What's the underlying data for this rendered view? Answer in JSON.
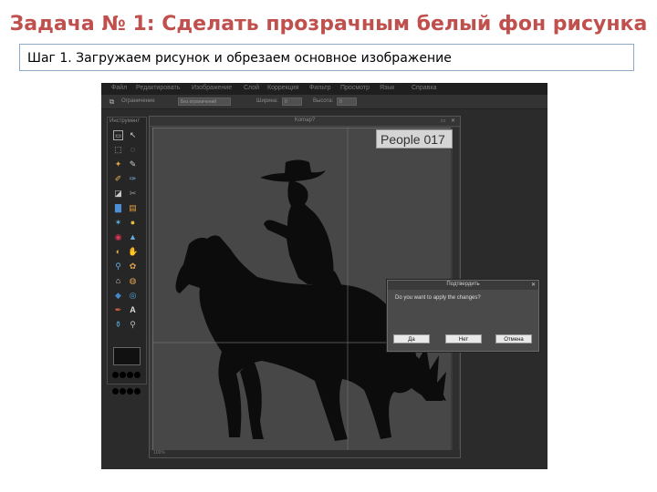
{
  "slide": {
    "title": "Задача № 1: Сделать прозрачным белый фон рисунка",
    "step": "Шаг 1. Загружаем рисунок и обрезаем основное изображение"
  },
  "editor": {
    "menu": [
      "Файл",
      "Редактировать",
      "Изображение",
      "Слой",
      "Коррекция",
      "Фильтр",
      "Просмотр",
      "Язык",
      "Справка"
    ],
    "options": {
      "label1": "Ограничение",
      "select1": "Без ограничений",
      "label2": "Ширина:",
      "value2": "0",
      "label3": "Высота:",
      "value3": "0"
    },
    "toolbox_title": "Инструмент",
    "document": {
      "title": "Komap?",
      "label": "People 017",
      "status": "100%"
    },
    "dialog": {
      "title": "Подтвердить",
      "close": "✕",
      "message": "Do you want to apply the changes?",
      "yes": "Да",
      "no": "Нет",
      "cancel": "Отмена"
    }
  },
  "colors": {
    "title": "#c0504d",
    "box_border": "#8ea9c9",
    "silhouette": "#0c0c0c",
    "canvas": "#474747"
  }
}
